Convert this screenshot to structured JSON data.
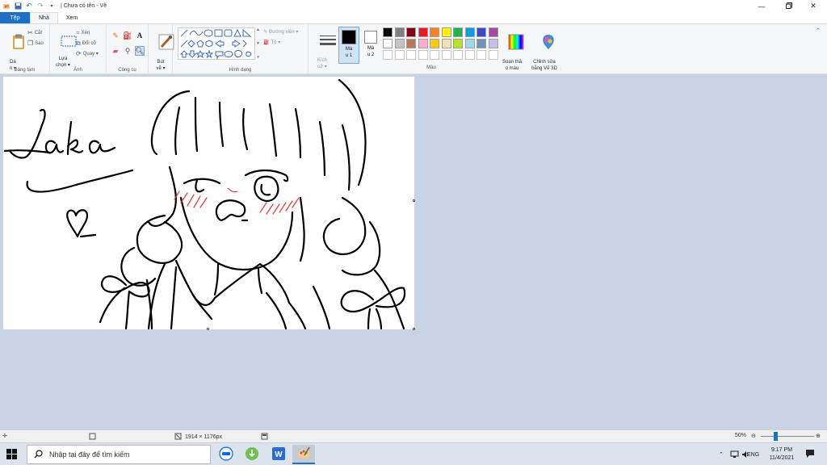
{
  "window": {
    "title": "| Chưa có tên - Vẽ",
    "minimize_icon": "minimize-icon",
    "maximize_icon": "restore-icon",
    "close_icon": "close-icon"
  },
  "tabs": [
    {
      "label": "Tệp"
    },
    {
      "label": "Nhà"
    },
    {
      "label": "Xem"
    }
  ],
  "ribbon": {
    "clipboard": {
      "paste": "Dá\nn ▾",
      "cut": "Cắt",
      "copy": "Sao",
      "label": "Bảng tạm"
    },
    "image": {
      "select": "Lựa\nchọn ▾",
      "crop": "Xén",
      "resize": "Đổi cỡ",
      "rotate": "Quay ▾",
      "label": "Ảnh"
    },
    "tools": {
      "label": "Công cụ"
    },
    "brushes": {
      "label": "Bút\nvẽ ▾"
    },
    "shapes": {
      "outline": "Đường viền ▾",
      "fill": "Tô ▾",
      "label": "Hình dạng"
    },
    "size": {
      "label": "Kích\ncỡ ▾"
    },
    "color1": {
      "label": "Mà\nu 1"
    },
    "color2": {
      "label": "Mà\nu 2"
    },
    "edit_colors": {
      "label": "Soạn thả\no màu"
    },
    "paint3d": {
      "label": "Chỉnh sửa\nbằng Vẽ 3D"
    },
    "colors_label": "Màu"
  },
  "palette": {
    "row1": [
      "#000000",
      "#7f7f7f",
      "#880015",
      "#ed1c24",
      "#ff7f27",
      "#fff200",
      "#22b14c",
      "#00a2e8",
      "#3f48cc",
      "#a349a4"
    ],
    "row2": [
      "#ffffff",
      "#c3c3c3",
      "#b97a57",
      "#ffaec9",
      "#ffc90e",
      "#efe4b0",
      "#b5e61d",
      "#99d9ea",
      "#7092be",
      "#c8bfe7"
    ],
    "color1": "#000000",
    "color2": "#ffffff"
  },
  "canvas": {
    "signature_text": "Laka"
  },
  "statusbar": {
    "dimensions": "1914 × 1176px",
    "zoom": "50%"
  },
  "taskbar": {
    "search_placeholder": "Nhập tại đây để tìm kiếm",
    "language": "ENG",
    "time": "9:17 PM",
    "date": "11/4/2021"
  }
}
